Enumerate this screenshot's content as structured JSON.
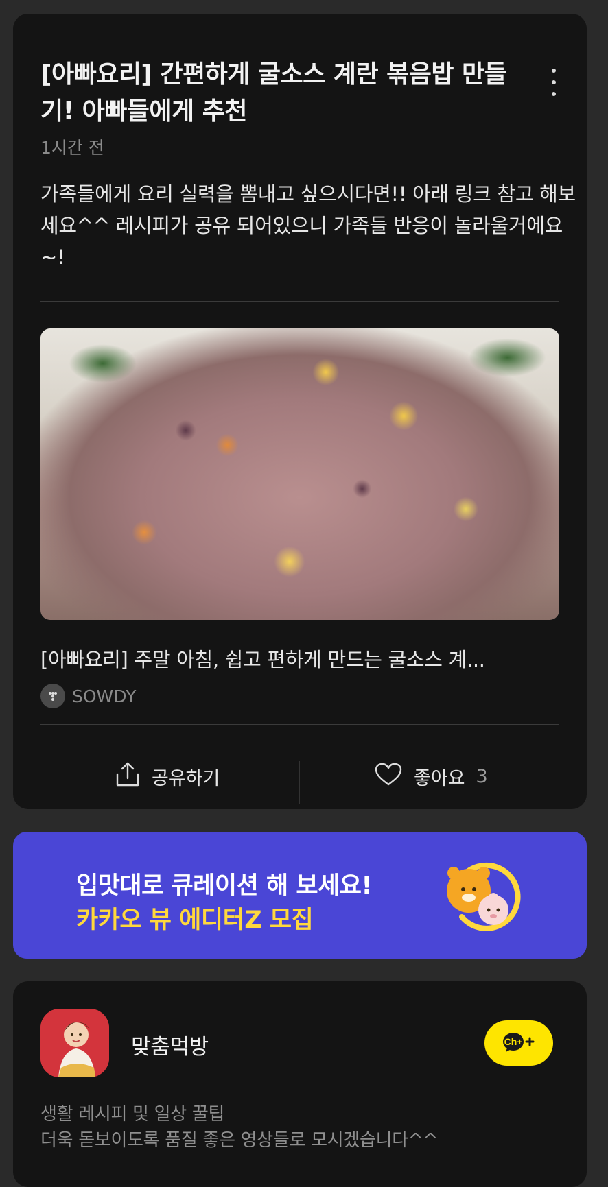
{
  "post": {
    "title": "[아빠요리] 간편하게 굴소스 계란 볶음밥 만들기! 아빠들에게 추천",
    "time": "1시간 전",
    "body": "가족들에게 요리 실력을 뽐내고 싶으시다면!! 아래 링크 참고 해보세요^^ 레시피가 공유 되어있으니 가족들 반응이 놀라울거에요~!",
    "more_icon": "more-vertical-icon",
    "link": {
      "image_alt": "fried rice with egg, carrot and sesame",
      "title": "[아빠요리] 주말 아침, 쉽고 편하게 만드는 굴소스 계...",
      "source": "SOWDY"
    },
    "actions": {
      "share_label": "공유하기",
      "like_label": "좋아요",
      "like_count": "3"
    }
  },
  "banner": {
    "line1": "입맛대로 큐레이션 해 보세요!",
    "line2": "카카오 뷰 에디터Z 모집",
    "line2_color": "#ffd83d",
    "background": "#4a46d6"
  },
  "channel": {
    "name": "맞춤먹방",
    "add_button_label": "Ch+",
    "desc_line1": "생활 레시피 및 일상 꿀팁",
    "desc_line2": "더욱 돋보이도록 품질 좋은 영상들로 모시겠습니다^^"
  },
  "colors": {
    "page_bg": "#2a2a2a",
    "card_bg": "#141414",
    "kakao_yellow": "#fee500"
  }
}
